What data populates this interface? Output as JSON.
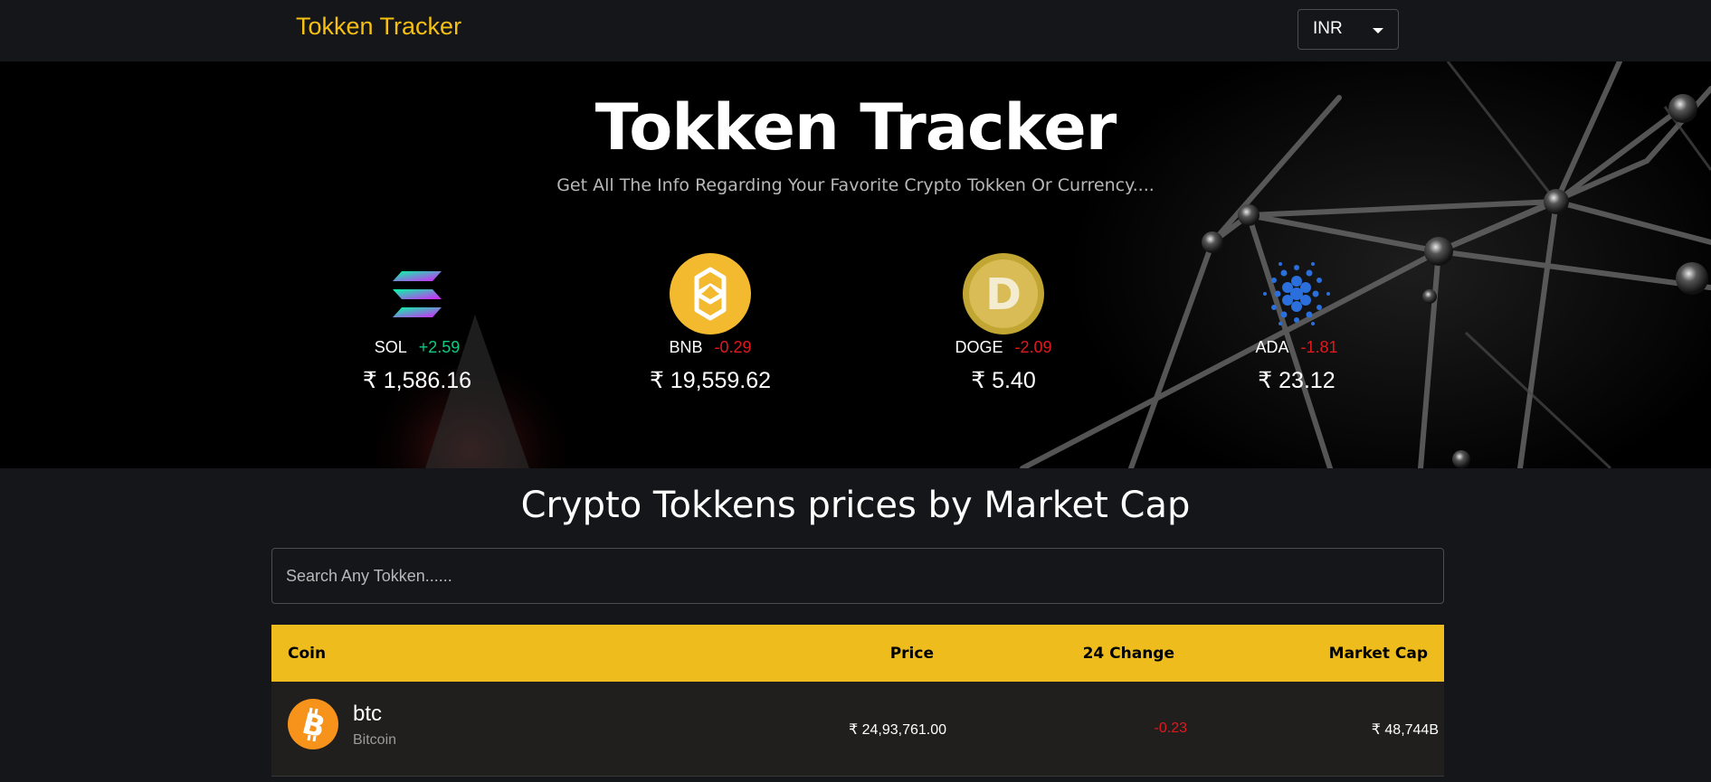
{
  "navbar": {
    "brand": "Tokken Tracker",
    "currency": "INR"
  },
  "hero": {
    "title": "Tokken Tracker",
    "subtitle": "Get All The Info Regarding Your Favorite Crypto Tokken Or Currency....",
    "coins": [
      {
        "symbol": "SOL",
        "change": "+2.59",
        "price": "₹ 1,586.16",
        "icon": "solana-logo"
      },
      {
        "symbol": "BNB",
        "change": "-0.29",
        "price": "₹ 19,559.62",
        "icon": "bnb-logo"
      },
      {
        "symbol": "DOGE",
        "change": "-2.09",
        "price": "₹ 5.40",
        "icon": "dogecoin-logo"
      },
      {
        "symbol": "ADA",
        "change": "-1.81",
        "price": "₹ 23.12",
        "icon": "cardano-logo"
      }
    ]
  },
  "market": {
    "title": "Crypto Tokkens prices by Market Cap",
    "search_placeholder": "Search Any Tokken......",
    "columns": [
      "Coin",
      "Price",
      "24 Change",
      "Market Cap"
    ],
    "rows": [
      {
        "symbol": "btc",
        "name": "Bitcoin",
        "price": "₹ 24,93,761.00",
        "change": "-0.23",
        "market_cap": "₹ 48,744B",
        "icon": "bitcoin-logo"
      }
    ]
  },
  "colors": {
    "accent": "#eebc1d",
    "brand": "#f5c012",
    "up": "#0ecb81",
    "down": "#e0191f"
  }
}
